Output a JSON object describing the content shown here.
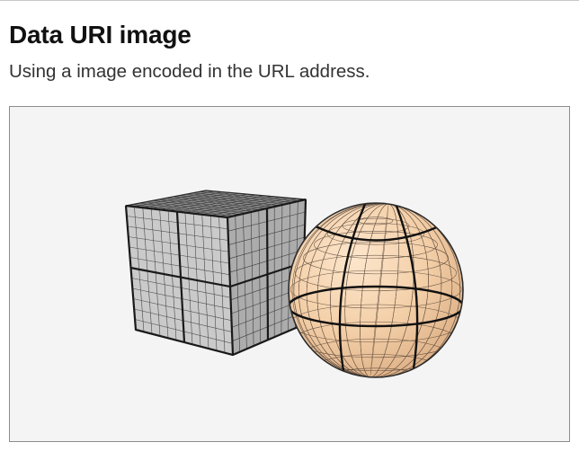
{
  "heading": {
    "title": "Data URI image",
    "subtitle": "Using a image encoded in the URL address."
  },
  "figure": {
    "subjects": [
      "cube-wireframe",
      "sphere-wireframe"
    ],
    "colors": {
      "background": "#f4f4f4",
      "cube_top": "#8e8e8e",
      "cube_left": "#c9c9c9",
      "cube_right": "#adadad",
      "sphere": "#f4d3b0"
    }
  }
}
